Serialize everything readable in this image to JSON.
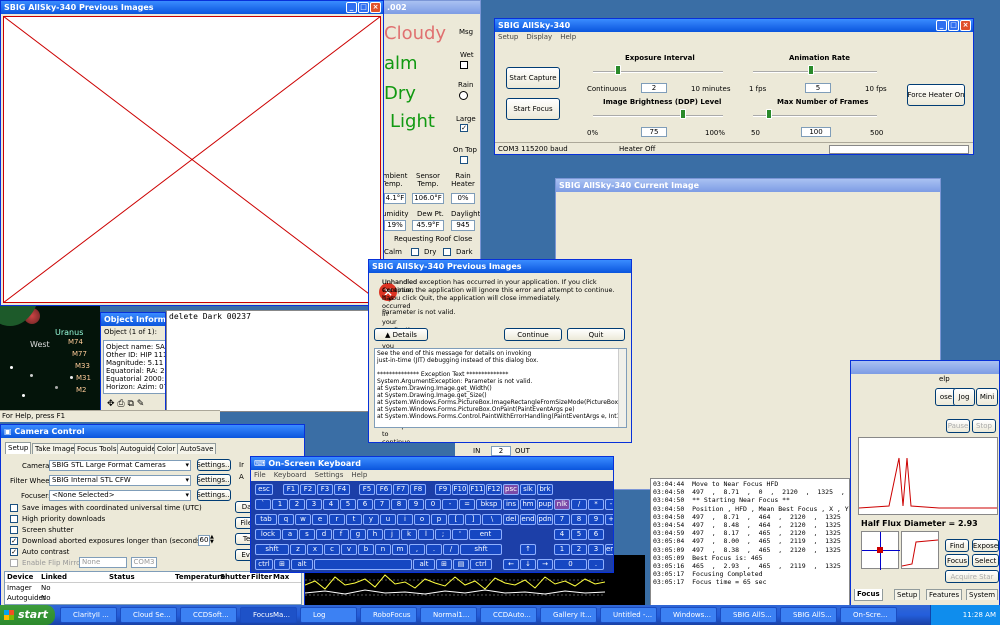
{
  "prev_images_window": {
    "title": "SBIG AllSky-340 Previous Images"
  },
  "weather": {
    "title_suffix": ".002",
    "states": [
      "Cloudy",
      "alm",
      "Dry",
      "Light"
    ],
    "checks": [
      "Msg",
      "Wet",
      "Rain",
      "Large",
      "On Top"
    ],
    "cols": [
      {
        "label": "Ambient Temp.",
        "value": "4.1°F"
      },
      {
        "label": "Sensor Temp.",
        "value": "106.0°F"
      },
      {
        "label": "Rain Heater",
        "value": "0%"
      }
    ],
    "cols2": [
      {
        "label": "umidity",
        "value": "19%"
      },
      {
        "label": "Dew Pt.",
        "value": "45.9°F"
      },
      {
        "label": "Daylight",
        "value": "945"
      }
    ],
    "roof": "Requesting Roof Close",
    "radios": [
      "Calm",
      "Dry",
      "Dark"
    ]
  },
  "allsky": {
    "title": "SBIG AllSky-340",
    "menu": [
      "Setup",
      "Display",
      "Help"
    ],
    "start_capture": "Start Capture",
    "start_focus": "Start Focus",
    "force_heater": "Force Heater On",
    "exposure": {
      "title": "Exposure Interval",
      "min": "Continuous",
      "value": "2",
      "max": "10 minutes"
    },
    "animation": {
      "title": "Animation Rate",
      "min": "1 fps",
      "value": "5",
      "max": "10 fps"
    },
    "brightness": {
      "title": "Image Brightness (DDP) Level",
      "min": "0%",
      "value": "75",
      "max": "100%"
    },
    "frames": {
      "title": "Max Number of Frames",
      "min": "50",
      "value": "100",
      "max": "500"
    },
    "status_port": "COM3  115200 baud",
    "status_heater": "Heater Off"
  },
  "current_image": {
    "title": "SBIG AllSky-340 Current Image"
  },
  "error_dialog": {
    "title": "SBIG AllSky-340 Previous Images",
    "message": "Unhandled exception has occurred in your application. If you click Continue, the application will ignore this error and attempt to continue. If you click Quit, the application will close immediately.",
    "detail": "Parameter is not valid.",
    "details_btn": "Details",
    "continue_btn": "Continue",
    "quit_btn": "Quit",
    "trace": [
      "See the end of this message for details on invoking",
      "just-in-time (JIT) debugging instead of this dialog box.",
      "",
      "************** Exception Text **************",
      "System.ArgumentException: Parameter is not valid.",
      "   at System.Drawing.Image.get_Width()",
      "   at System.Drawing.Image.get_Size()",
      "   at System.Windows.Forms.PictureBox.ImageRectangleFromSizeMode(PictureBoxS",
      "   at System.Windows.Forms.PictureBox.OnPaint(PaintEventArgs pe)",
      "   at System.Windows.Forms.Control.PaintWithErrorHandling(PaintEventArgs e, Int16"
    ]
  },
  "planetarium": {
    "labels": [
      "Uranus",
      "West",
      "M74",
      "M77",
      "M33",
      "M31",
      "M2"
    ]
  },
  "object_info": {
    "title": "Object Informatio",
    "count": "Object (1 of 1):",
    "lines": [
      "Object name: SAO",
      "Other ID: HIP 1117",
      "Magnitude: 5.11",
      "Equatorial: RA: 22h",
      "Equatorial 2000: RA",
      "Horizon: Azim: 07°5"
    ]
  },
  "ccd_console": {
    "text": "delete Dark 00237"
  },
  "help_status": "For Help, press F1",
  "camera_control": {
    "title": "Camera Control",
    "tabs": [
      "Setup",
      "Take Image",
      "Focus Tools",
      "Autoguide",
      "Color",
      "AutoSave"
    ],
    "camera_label": "Camera:",
    "camera_value": "SBIG STL Large Format Cameras",
    "filter_label": "Filter Wheel:",
    "filter_value": "SBIG Internal STL CFW",
    "focuser_label": "Focuser:",
    "focuser_value": "<None Selected>",
    "settings": "Settings...",
    "options": [
      {
        "label": "Save images with coordinated universal time (UTC)",
        "checked": false
      },
      {
        "label": "High priority downloads",
        "checked": false
      },
      {
        "label": "Screen shutter",
        "checked": false
      },
      {
        "label": "Download aborted exposures longer than (seconds):",
        "checked": true
      },
      {
        "label": "Auto contrast",
        "checked": true
      },
      {
        "label": "Enable Flip Mirror",
        "checked": false
      }
    ],
    "download_secs": "60",
    "flip_none": "None",
    "flip_com": "COM3",
    "table_headers": [
      "Device",
      "Linked",
      "Status",
      "Temperature",
      "Shutter",
      "Filter",
      "Max"
    ],
    "table_rows": [
      [
        "Imager",
        "No"
      ],
      [
        "Autoguider",
        "No"
      ]
    ],
    "side_btns": [
      "Dark",
      "File N",
      "Tem",
      "Even"
    ],
    "side_radios": [
      "Ir",
      "A"
    ]
  },
  "osk": {
    "title": "On-Screen Keyboard",
    "menu": [
      "File",
      "Keyboard",
      "Settings",
      "Help"
    ]
  },
  "focus_log": {
    "lines": [
      "03:04:44  Move to Near Focus HFD",
      "03:04:50  497  ,  8.71  ,  0  ,  2120  ,  1325  ,  1118882",
      "03:04:50  ** Starting Near Focus **",
      "03:04:50  Position , HFD , Mean Best Focus , X , Y , Flux",
      "03:04:50  497  ,  8.71  ,  464  ,  2120  ,  1325  ,  1118882",
      "03:04:54  497  ,  8.48  ,  464  ,  2120  ,  1325  ,  1098727",
      "03:04:59  497  ,  8.17  ,  465  ,  2120  ,  1325  ,  1061641",
      "03:05:04  497  ,  8.00  ,  465  ,  2119  ,  1325  ,  1047170",
      "03:05:09  497  ,  8.38  ,  465  ,  2120  ,  1325  ,  1114028",
      "03:05:09  Best Focus is: 465",
      "03:05:16  465  ,  2.93  ,  465  ,  2119  ,  1325  ,  809659",
      "03:05:17  Focusing Completed",
      "03:05:17  Focus time = 65 sec"
    ]
  },
  "focusmax": {
    "help": "elp",
    "btns": [
      "ose",
      "Jog",
      "Mini"
    ],
    "pause": "Pause",
    "stop": "Stop",
    "hfd": "Half Flux Diameter = 2.93",
    "find": "Find",
    "expose": "Expose",
    "focus": "Focus",
    "select": "Select",
    "acquire": "Acquire Star",
    "tabs": [
      "Focus",
      "Setup",
      "Features",
      "System"
    ]
  },
  "robofocus": {
    "in": "IN",
    "step": "2",
    "out": "OUT",
    "sed": "sed"
  },
  "taskbar": {
    "start": "start",
    "clock": "11:28 AM",
    "tasks": [
      "ClarityII ...",
      "Cloud Se...",
      "CCDSoft...",
      "FocusMa...",
      "Log",
      "RoboFocus",
      "Normal1...",
      "CCDAuto...",
      "Gallery It...",
      "Untitled -...",
      "Windows...",
      "SBIG AllS...",
      "SBIG AllS...",
      "On-Scre..."
    ]
  }
}
